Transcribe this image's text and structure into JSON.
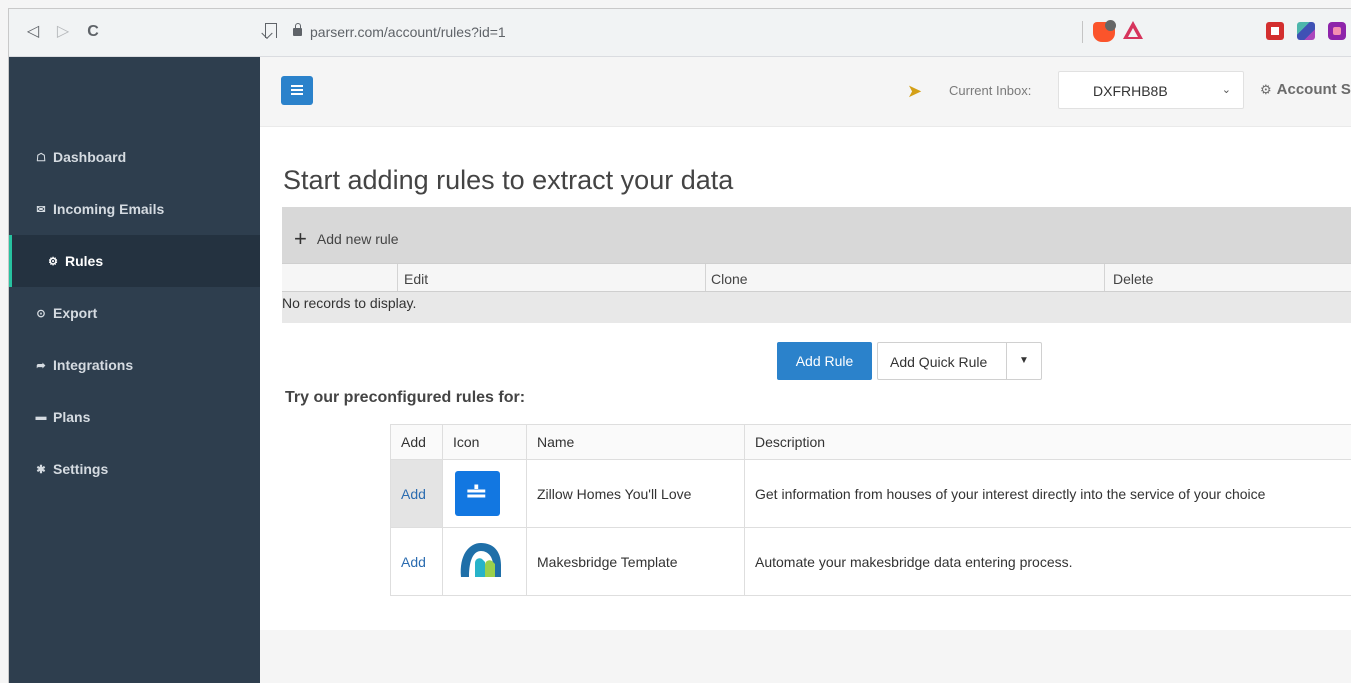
{
  "browser": {
    "back": "◁",
    "forward": "▷",
    "reload": "C",
    "url": "parserr.com/account/rules?id=1"
  },
  "sidebar": {
    "items": [
      {
        "label": "Dashboard",
        "icon": "home-icon"
      },
      {
        "label": "Incoming Emails",
        "icon": "envelope-icon"
      },
      {
        "label": "Rules",
        "icon": "sitemap-icon",
        "active": true
      },
      {
        "label": "Export",
        "icon": "export-icon"
      },
      {
        "label": "Integrations",
        "icon": "share-icon"
      },
      {
        "label": "Plans",
        "icon": "card-icon"
      },
      {
        "label": "Settings",
        "icon": "gear-icon"
      }
    ]
  },
  "topbar": {
    "inbox_label": "Current Inbox:",
    "inbox_value": "DXFRHB8B",
    "account_label": "Account S"
  },
  "page": {
    "title": "Start adding rules to extract your data"
  },
  "grid": {
    "add_new": "Add new rule",
    "columns": [
      "Edit",
      "Clone",
      "Delete"
    ],
    "empty_text": "No records to display."
  },
  "actions": {
    "add_rule": "Add Rule",
    "add_quick_rule": "Add Quick Rule"
  },
  "preconfigured": {
    "title": "Try our preconfigured rules for:",
    "columns": [
      "Add",
      "Icon",
      "Name",
      "Description"
    ],
    "rows": [
      {
        "add": "Add",
        "icon": "zillow-icon",
        "name": "Zillow Homes You'll Love",
        "description": "Get information from houses of your interest directly into the service of your choice"
      },
      {
        "add": "Add",
        "icon": "makesbridge-icon",
        "name": "Makesbridge Template",
        "description": "Automate your makesbridge data entering process."
      }
    ]
  },
  "colors": {
    "sidebar": "#2e3e4e",
    "accent": "#2b82cb",
    "active_bar": "#27c2a0"
  }
}
